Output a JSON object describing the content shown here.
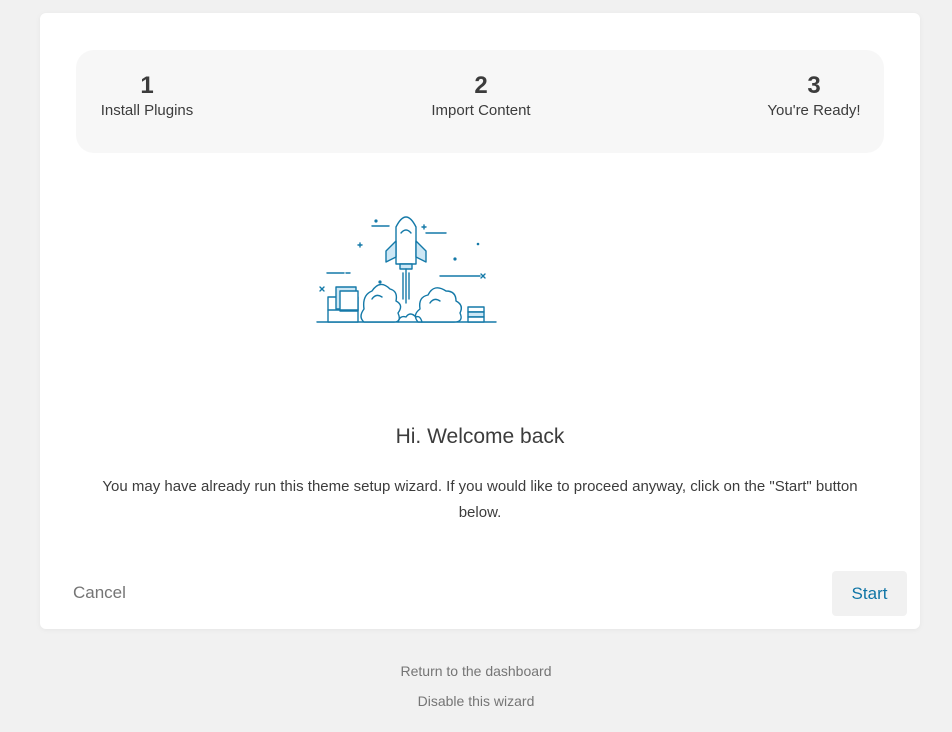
{
  "steps": [
    {
      "number": "1",
      "label": "Install Plugins"
    },
    {
      "number": "2",
      "label": "Import Content"
    },
    {
      "number": "3",
      "label": "You're Ready!"
    }
  ],
  "content": {
    "illustration": "rocket-launch-illustration",
    "title": "Hi. Welcome back",
    "description": "You may have already run this theme setup wizard. If you would like to proceed anyway, click on the \"Start\" button below."
  },
  "actions": {
    "cancel_label": "Cancel",
    "start_label": "Start"
  },
  "footer": {
    "dashboard_link": "Return to the dashboard",
    "disable_link": "Disable this wizard"
  },
  "colors": {
    "accent": "#0f75a6",
    "illustration_stroke": "#1479a8",
    "illustration_fill": "#cde7f5"
  }
}
